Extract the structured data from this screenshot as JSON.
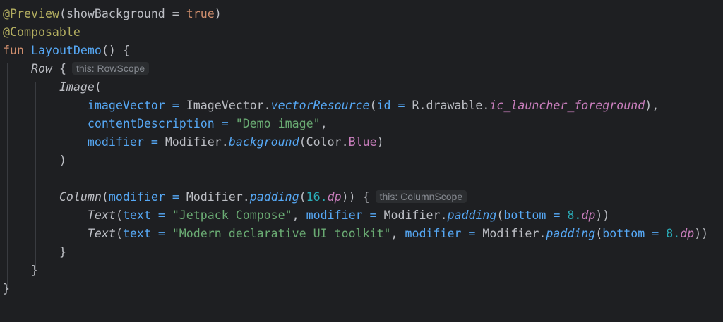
{
  "code": {
    "l1": {
      "annotation": "@Preview",
      "open": "(",
      "param": "showBackground",
      "eq": " = ",
      "value": "true",
      "close": ")"
    },
    "l2": {
      "annotation": "@Composable"
    },
    "l3": {
      "keyword": "fun",
      "name": "LayoutDemo",
      "rest": "() {"
    },
    "l4": {
      "call": "Row",
      "brace": " {",
      "hint": "this: RowScope"
    },
    "l5": {
      "call": "Image",
      "open": "("
    },
    "l6": {
      "param": "imageVector",
      "eq": " = ",
      "obj": "ImageVector.",
      "method": "vectorResource",
      "open": "(",
      "param2": "id",
      "eq2": " = ",
      "ref": "R.drawable.",
      "res": "ic_launcher_foreground",
      "close": "),"
    },
    "l7": {
      "param": "contentDescription",
      "eq": " = ",
      "string": "\"Demo image\"",
      "comma": ","
    },
    "l8": {
      "param": "modifier",
      "eq": " = ",
      "obj": "Modifier.",
      "method": "background",
      "open": "(",
      "obj2": "Color.",
      "prop": "Blue",
      "close": ")"
    },
    "l9": {
      "close": ")"
    },
    "l11": {
      "call": "Column",
      "open": "(",
      "param": "modifier",
      "eq": " = ",
      "obj": "Modifier.",
      "method": "padding",
      "open2": "(",
      "num": "16.",
      "unit": "dp",
      "close": ")) {",
      "hint": "this: ColumnScope"
    },
    "l12": {
      "call": "Text",
      "open": "(",
      "param": "text",
      "eq": " = ",
      "string": "\"Jetpack Compose\"",
      "comma": ", ",
      "param2": "modifier",
      "eq2": " = ",
      "obj": "Modifier.",
      "method": "padding",
      "open2": "(",
      "param3": "bottom",
      "eq3": " = ",
      "num": "8.",
      "unit": "dp",
      "close": "))"
    },
    "l13": {
      "call": "Text",
      "open": "(",
      "param": "text",
      "eq": " = ",
      "string": "\"Modern declarative UI toolkit\"",
      "comma": ", ",
      "param2": "modifier",
      "eq2": " = ",
      "obj": "Modifier.",
      "method": "padding",
      "open2": "(",
      "param3": "bottom",
      "eq3": " = ",
      "num": "8.",
      "unit": "dp",
      "close": "))"
    },
    "l14": {
      "close": "}"
    },
    "l15": {
      "close": "}"
    },
    "l16": {
      "close": "}"
    }
  }
}
